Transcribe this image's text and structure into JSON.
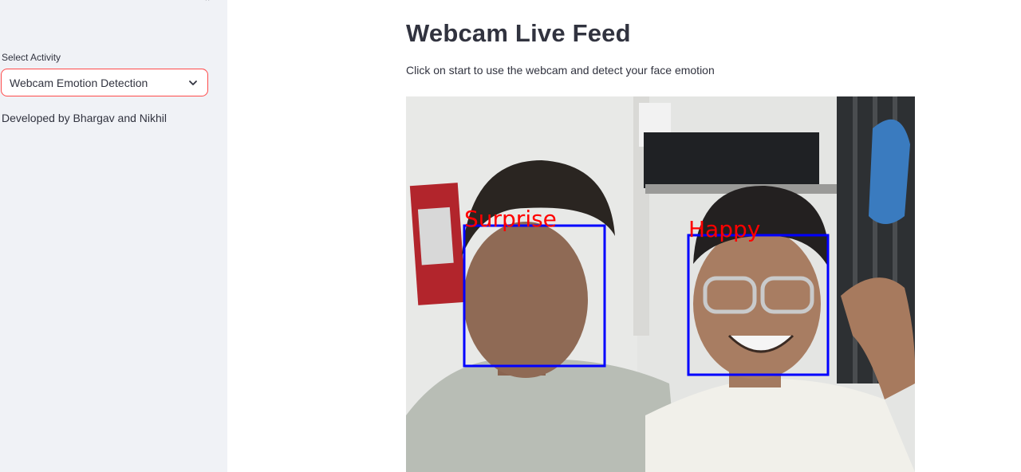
{
  "sidebar": {
    "select_label": "Select Activity",
    "select_value": "Webcam Emotion Detection",
    "credit": "Developed by Bhargav and Nikhil"
  },
  "main": {
    "title": "Webcam Live Feed",
    "subtitle": "Click on start to use the webcam and detect your face emotion"
  },
  "video": {
    "detections": [
      {
        "label": "Surprise"
      },
      {
        "label": "Happy"
      }
    ]
  },
  "colors": {
    "sidebar_bg": "#f0f2f6",
    "select_border": "#ff4b4b",
    "detection_box": "#0000ff",
    "detection_label": "#ff0000"
  },
  "icons": {
    "select_arrow": "chevron-down-icon",
    "sidebar_toggle": "collapse-icon"
  }
}
